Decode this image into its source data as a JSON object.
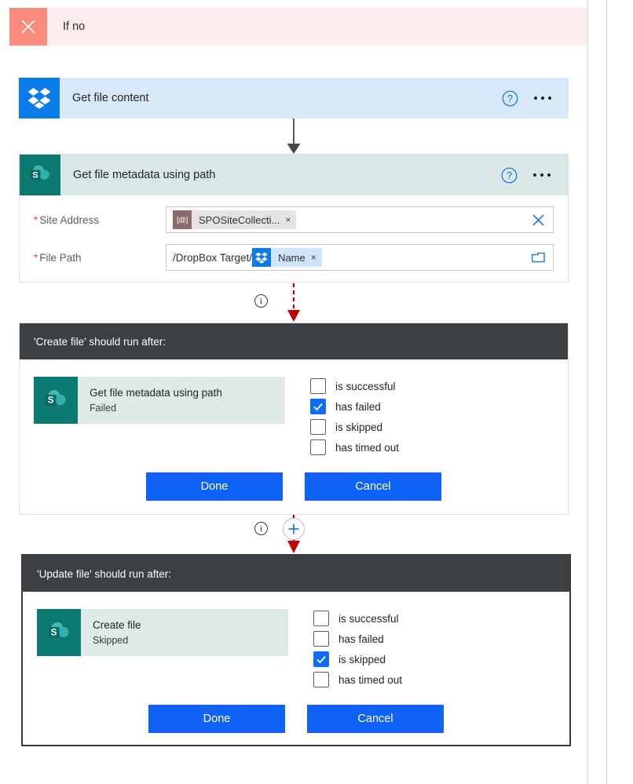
{
  "branch": {
    "title": "If no",
    "close_icon": "close-icon"
  },
  "cards": [
    {
      "id": "dropbox",
      "title": "Get file content",
      "connector": "dropbox",
      "help_icon": "help-circle-icon",
      "menu_icon": "ellipsis-icon"
    },
    {
      "id": "sharepoint",
      "title": "Get file metadata using path",
      "connector": "sharepoint",
      "help_icon": "help-circle-icon",
      "menu_icon": "ellipsis-icon",
      "fields": [
        {
          "label": "Site Address",
          "required": true,
          "required_mark": "*",
          "token": {
            "badge": "[@]",
            "badge_kind": "at",
            "text": "SPOSiteCollecti...",
            "remove": "×"
          },
          "prefix_text": "",
          "trailing_icon": "clear-x-icon"
        },
        {
          "label": "File Path",
          "required": true,
          "required_mark": "*",
          "prefix_text": "/DropBox Target/",
          "token": {
            "badge": "dropbox-icon",
            "badge_kind": "dbx",
            "text": "Name",
            "remove": "×"
          },
          "trailing_icon": "folder-picker-icon"
        }
      ]
    }
  ],
  "connectors": [
    {
      "id": "arrow-dropbox-to-sharepoint",
      "style": "solid-gray",
      "icon": "down-arrow-icon"
    },
    {
      "id": "arrow-sharepoint-to-create",
      "style": "dashed-red",
      "icon": "down-arrow-icon",
      "info_icon": "info-icon",
      "info_glyph": "i"
    },
    {
      "id": "arrow-create-to-update",
      "style": "dashed-red",
      "icon": "down-arrow-icon",
      "info_icon": "info-icon",
      "info_glyph": "i",
      "add_icon": "plus-icon"
    }
  ],
  "run_after_panels": [
    {
      "id": "create-file",
      "heading": "'Create file' should run after:",
      "action": {
        "title": "Get file metadata using path",
        "status": "Failed",
        "connector": "sharepoint"
      },
      "options": [
        {
          "label": "is successful",
          "checked": false
        },
        {
          "label": "has failed",
          "checked": true
        },
        {
          "label": "is skipped",
          "checked": false
        },
        {
          "label": "has timed out",
          "checked": false
        }
      ],
      "buttons": {
        "done": "Done",
        "cancel": "Cancel"
      }
    },
    {
      "id": "update-file",
      "heading": "'Update file' should run after:",
      "action": {
        "title": "Create file",
        "status": "Skipped",
        "connector": "sharepoint"
      },
      "options": [
        {
          "label": "is successful",
          "checked": false
        },
        {
          "label": "has failed",
          "checked": false
        },
        {
          "label": "is skipped",
          "checked": true
        },
        {
          "label": "has timed out",
          "checked": false
        }
      ],
      "buttons": {
        "done": "Done",
        "cancel": "Cancel"
      }
    }
  ],
  "colors": {
    "branch_header_bg": "#fdeeee",
    "branch_close_bg": "#f98c7d",
    "dropbox_blue": "#0a7cea",
    "sharepoint_teal": "#0d7a72",
    "panel_header": "#3b4045",
    "primary_button": "#0f62f5",
    "checkbox_checked": "#0f6cf5",
    "error_red": "#c00000",
    "required_red": "#e04a4a"
  }
}
